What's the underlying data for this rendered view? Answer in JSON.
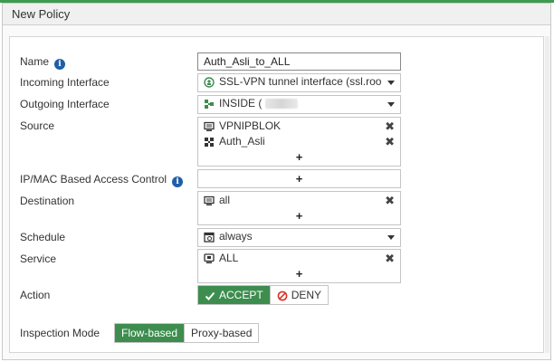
{
  "window": {
    "title": "New Policy"
  },
  "form": {
    "name": {
      "label": "Name",
      "value": "Auth_Asli_to_ALL"
    },
    "incoming": {
      "label": "Incoming Interface",
      "value": "SSL-VPN tunnel interface (ssl.roo",
      "icon": "ssl-vpn-icon"
    },
    "outgoing": {
      "label": "Outgoing Interface",
      "value": "INSIDE (",
      "icon": "port-icon"
    },
    "source": {
      "label": "Source",
      "items": [
        {
          "label": "VPNIPBLOK",
          "icon": "address-icon"
        },
        {
          "label": "Auth_Asli",
          "icon": "user-group-icon"
        }
      ]
    },
    "ipmac": {
      "label": "IP/MAC Based Access Control"
    },
    "destination": {
      "label": "Destination",
      "items": [
        {
          "label": "all",
          "icon": "address-icon"
        }
      ]
    },
    "schedule": {
      "label": "Schedule",
      "value": "always",
      "icon": "schedule-icon"
    },
    "service": {
      "label": "Service",
      "items": [
        {
          "label": "ALL",
          "icon": "service-icon"
        }
      ]
    },
    "action": {
      "label": "Action",
      "accept": "ACCEPT",
      "deny": "DENY",
      "selected": "ACCEPT"
    },
    "inspection": {
      "label": "Inspection Mode",
      "flow": "Flow-based",
      "proxy": "Proxy-based",
      "selected": "Flow-based"
    }
  },
  "symbols": {
    "add": "+",
    "remove": "✖",
    "info": "i"
  },
  "colors": {
    "accent": "#3d8d4f",
    "info": "#1f5fa8",
    "deny": "#d9342b"
  }
}
